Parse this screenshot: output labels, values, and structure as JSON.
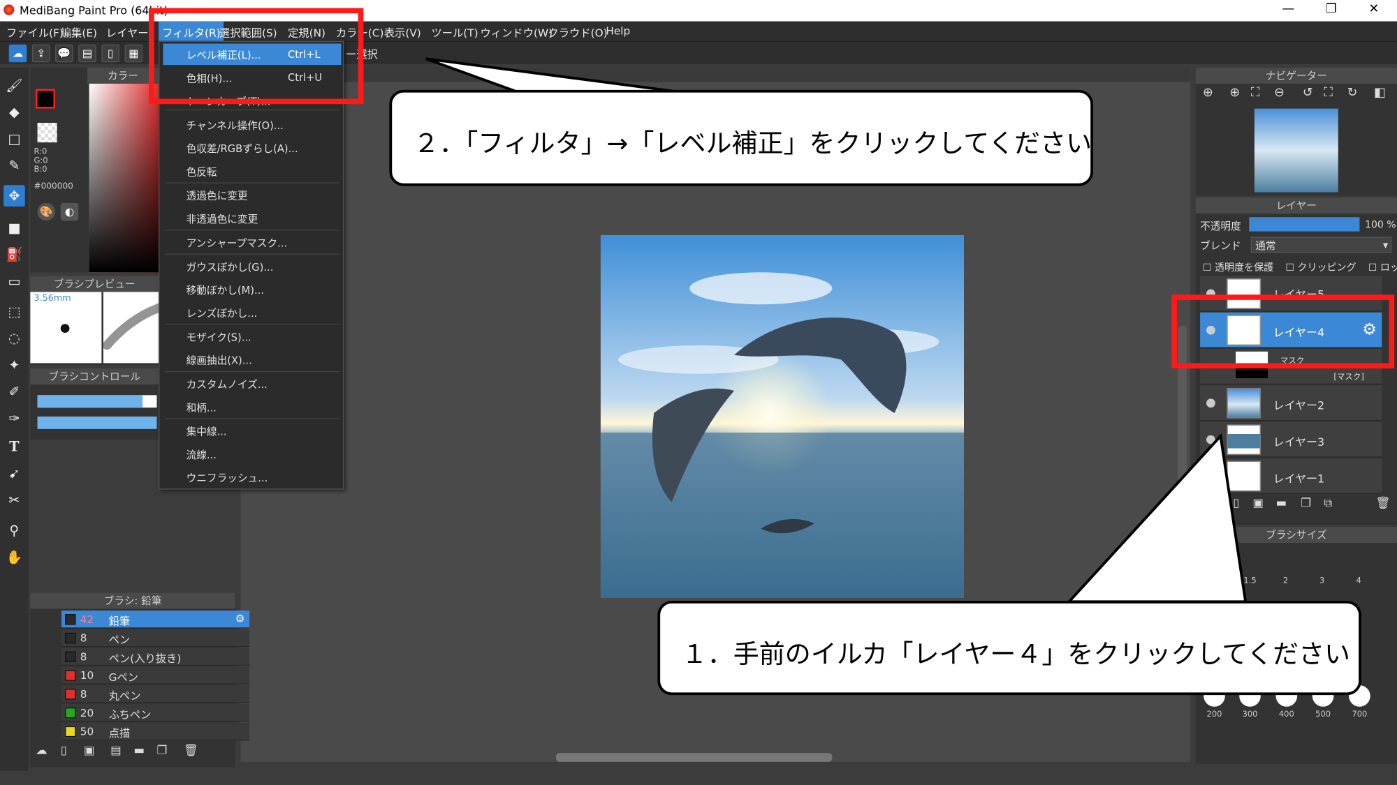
{
  "window": {
    "title": "MediBang Paint Pro (64bit)",
    "min": "—",
    "max": "❐",
    "close": "✕"
  },
  "menubar": [
    "ファイル(F)",
    "編集(E)",
    "レイヤー(L)",
    "フィルタ(R)",
    "選択範囲(S)",
    "定規(N)",
    "カラー(C)",
    "表示(V)",
    "ツール(T)",
    "ウィンドウ(W)",
    "クラウド(O)",
    "Help"
  ],
  "toolbar": {
    "select_suffix": "ー選択"
  },
  "filter_menu": {
    "items": [
      {
        "label": "レベル補正(L)...",
        "shortcut": "Ctrl+L"
      },
      {
        "label": "色相(H)...",
        "shortcut": "Ctrl+U"
      },
      {
        "label": "トーンカーブ(T)...",
        "shortcut": ""
      },
      {
        "label": "チャンネル操作(O)...",
        "shortcut": ""
      },
      {
        "label": "色収差/RGBずらし(A)...",
        "shortcut": ""
      },
      {
        "label": "色反転",
        "shortcut": ""
      },
      {
        "label": "透過色に変更",
        "shortcut": ""
      },
      {
        "label": "非透過色に変更",
        "shortcut": ""
      },
      {
        "label": "アンシャープマスク...",
        "shortcut": ""
      },
      {
        "label": "ガウスぼかし(G)...",
        "shortcut": ""
      },
      {
        "label": "移動ぼかし(M)...",
        "shortcut": ""
      },
      {
        "label": "レンズぼかし...",
        "shortcut": ""
      },
      {
        "label": "モザイク(S)...",
        "shortcut": ""
      },
      {
        "label": "線画抽出(X)...",
        "shortcut": ""
      },
      {
        "label": "カスタムノイズ...",
        "shortcut": ""
      },
      {
        "label": "和柄...",
        "shortcut": ""
      },
      {
        "label": "集中線...",
        "shortcut": ""
      },
      {
        "label": "流線...",
        "shortcut": ""
      },
      {
        "label": "ウニフラッシュ...",
        "shortcut": ""
      }
    ]
  },
  "color_panel": {
    "title": "カラー",
    "r": "R:0",
    "g": "G:0",
    "b": "B:0",
    "hex": "#000000"
  },
  "brush_preview": {
    "title": "ブラシプレビュー",
    "size": "3.56mm"
  },
  "brush_control": {
    "title": "ブラシコントロール"
  },
  "brush_panel": {
    "title": "ブラシ: 鉛筆",
    "items": [
      {
        "size": "42",
        "name": "鉛筆",
        "color": "#2a2a2a"
      },
      {
        "size": "8",
        "name": "ペン",
        "color": "#2a2a2a"
      },
      {
        "size": "8",
        "name": "ペン(入り抜き)",
        "color": "#2a2a2a"
      },
      {
        "size": "10",
        "name": "Gペン",
        "color": "#e03030"
      },
      {
        "size": "8",
        "name": "丸ペン",
        "color": "#e03030"
      },
      {
        "size": "20",
        "name": "ふちペン",
        "color": "#22aa22"
      },
      {
        "size": "50",
        "name": "点描",
        "color": "#e8d820"
      }
    ]
  },
  "navigator": {
    "title": "ナビゲーター"
  },
  "layer_panel": {
    "title": "レイヤー",
    "opacity_label": "不透明度",
    "opacity_value": "100 %",
    "blend_label": "ブレンド",
    "blend_value": "通常",
    "protect": "透明度を保護",
    "clipping": "クリッピング",
    "lock": "ロック",
    "mask_tag": "[マスク]",
    "layers": [
      "レイヤー5",
      "レイヤー4",
      "マスク",
      "レイヤー2",
      "レイヤー3",
      "レイヤー1"
    ]
  },
  "brush_size": {
    "title": "ブラシサイズ",
    "top": [
      "1.5",
      "2",
      "3",
      "4"
    ],
    "bottom": [
      "200",
      "300",
      "400",
      "500",
      "700"
    ]
  },
  "annotations": {
    "step2": "２．「フィルタ」→「レベル補正」をクリックしてください",
    "step1": "１．手前のイルカ「レイヤー４」をクリックしてください"
  },
  "colors": {
    "accent": "#3a88d6",
    "highlight": "#ff1a1a"
  }
}
